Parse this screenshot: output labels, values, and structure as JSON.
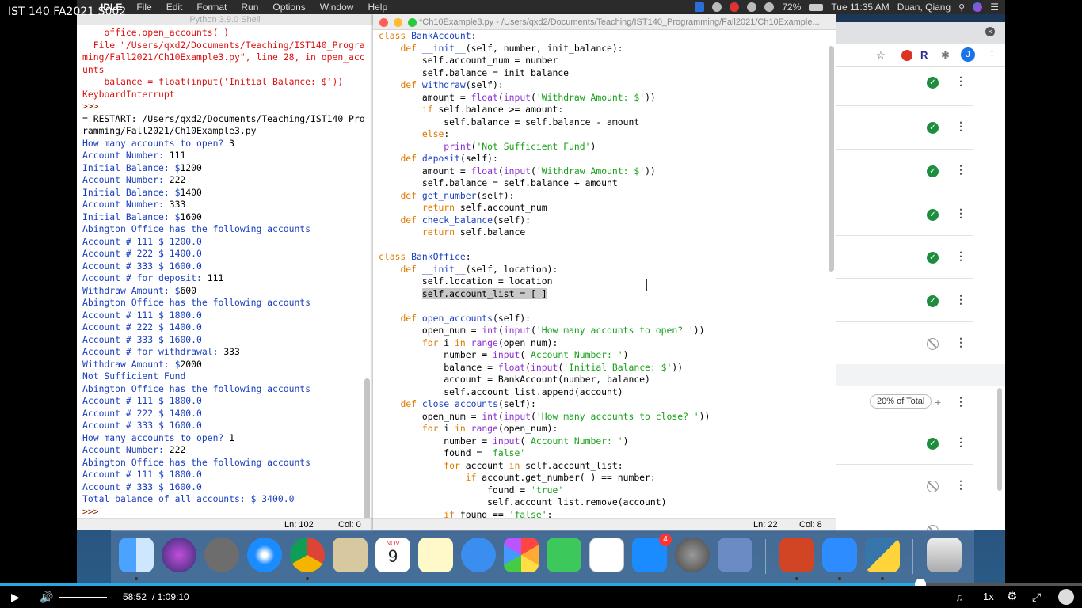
{
  "video": {
    "title": "IST 140 FA2021 S002",
    "current_time": "58:52",
    "total_time": "/ 1:09:10",
    "progress": 0.851,
    "volume": 1.0,
    "speed": "1x"
  },
  "menubar": {
    "items": [
      "IDLE",
      "File",
      "Edit",
      "Format",
      "Run",
      "Options",
      "Window",
      "Help"
    ],
    "battery": "72%",
    "clock": "Tue 11:35 AM",
    "user": "Duan, Qiang"
  },
  "shell": {
    "title": "Python 3.9.0 Shell",
    "status_ln": "Ln: 102",
    "status_col": "Col: 0"
  },
  "editor": {
    "title": "*Ch10Example3.py - /Users/qxd2/Documents/Teaching/IST140_Programming/Fall2021/Ch10Example...",
    "status_ln": "Ln: 22",
    "status_col": "Col: 8"
  },
  "browser": {
    "percent_badge": "20% of Total",
    "profile_initial": "J",
    "ext_r": "R"
  },
  "dock": {
    "calendar_month": "NOV",
    "calendar_day": "9",
    "appstore_badge": "4"
  },
  "colors": {
    "accent": "#2aa7e0",
    "shell_error": "#d11111",
    "shell_output": "#1a3fbf",
    "keyword": "#e07a00",
    "string": "#17a01a",
    "builtin": "#8a2fcf",
    "check_green": "#1e8e3e"
  }
}
